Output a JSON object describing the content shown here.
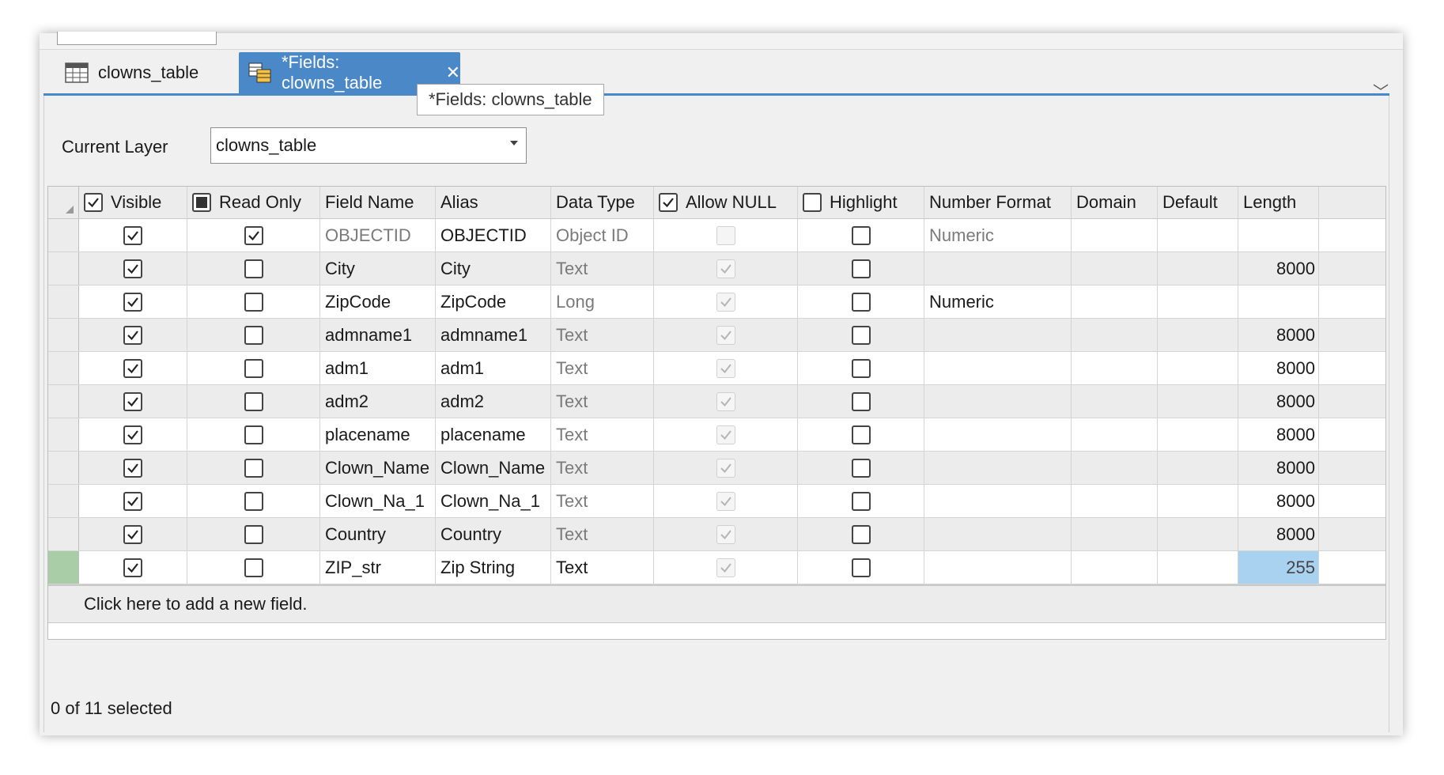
{
  "tabs": [
    {
      "label": "clowns_table",
      "icon": "table-icon",
      "active": false
    },
    {
      "label": "*Fields: clowns_table",
      "icon": "fields-view-icon",
      "active": true
    }
  ],
  "tooltip": "*Fields: clowns_table",
  "current_layer": {
    "label": "Current Layer",
    "value": "clowns_table"
  },
  "columns": {
    "visible": "Visible",
    "read_only": "Read Only",
    "field_name": "Field Name",
    "alias": "Alias",
    "data_type": "Data Type",
    "allow_null": "Allow NULL",
    "highlight": "Highlight",
    "number_format": "Number Format",
    "domain": "Domain",
    "default": "Default",
    "length": "Length"
  },
  "header_checks": {
    "visible": "checked",
    "read_only": "indeterminate",
    "allow_null": "checked",
    "highlight": "unchecked"
  },
  "rows": [
    {
      "visible": true,
      "read_only": true,
      "field_name": "OBJECTID",
      "alias": "OBJECTID",
      "data_type": "Object ID",
      "allow_null": false,
      "highlight": false,
      "number_format": "Numeric",
      "domain": "",
      "default": "",
      "length": ""
    },
    {
      "visible": true,
      "read_only": false,
      "field_name": "City",
      "alias": "City",
      "data_type": "Text",
      "allow_null": true,
      "highlight": false,
      "number_format": "",
      "domain": "",
      "default": "",
      "length": "8000"
    },
    {
      "visible": true,
      "read_only": false,
      "field_name": "ZipCode",
      "alias": "ZipCode",
      "data_type": "Long",
      "allow_null": true,
      "highlight": false,
      "number_format": "Numeric",
      "domain": "",
      "default": "",
      "length": ""
    },
    {
      "visible": true,
      "read_only": false,
      "field_name": "admname1",
      "alias": "admname1",
      "data_type": "Text",
      "allow_null": true,
      "highlight": false,
      "number_format": "",
      "domain": "",
      "default": "",
      "length": "8000"
    },
    {
      "visible": true,
      "read_only": false,
      "field_name": "adm1",
      "alias": "adm1",
      "data_type": "Text",
      "allow_null": true,
      "highlight": false,
      "number_format": "",
      "domain": "",
      "default": "",
      "length": "8000"
    },
    {
      "visible": true,
      "read_only": false,
      "field_name": "adm2",
      "alias": "adm2",
      "data_type": "Text",
      "allow_null": true,
      "highlight": false,
      "number_format": "",
      "domain": "",
      "default": "",
      "length": "8000"
    },
    {
      "visible": true,
      "read_only": false,
      "field_name": "placename",
      "alias": "placename",
      "data_type": "Text",
      "allow_null": true,
      "highlight": false,
      "number_format": "",
      "domain": "",
      "default": "",
      "length": "8000"
    },
    {
      "visible": true,
      "read_only": false,
      "field_name": "Clown_Name",
      "alias": "Clown_Name",
      "data_type": "Text",
      "allow_null": true,
      "highlight": false,
      "number_format": "",
      "domain": "",
      "default": "",
      "length": "8000"
    },
    {
      "visible": true,
      "read_only": false,
      "field_name": "Clown_Na_1",
      "alias": "Clown_Na_1",
      "data_type": "Text",
      "allow_null": true,
      "highlight": false,
      "number_format": "",
      "domain": "",
      "default": "",
      "length": "8000"
    },
    {
      "visible": true,
      "read_only": false,
      "field_name": "Country",
      "alias": "Country",
      "data_type": "Text",
      "allow_null": true,
      "highlight": false,
      "number_format": "",
      "domain": "",
      "default": "",
      "length": "8000"
    },
    {
      "visible": true,
      "read_only": false,
      "field_name": "ZIP_str",
      "alias": "Zip String",
      "data_type": "Text",
      "allow_null": true,
      "highlight": false,
      "number_format": "",
      "domain": "",
      "default": "",
      "length": "255"
    }
  ],
  "add_field_text": "Click here to add a new field.",
  "status": "0 of 11 selected",
  "colors": {
    "accent": "#4b88c8",
    "new_row_marker": "#a9cda6",
    "length_selected": "#a9d1f0"
  }
}
